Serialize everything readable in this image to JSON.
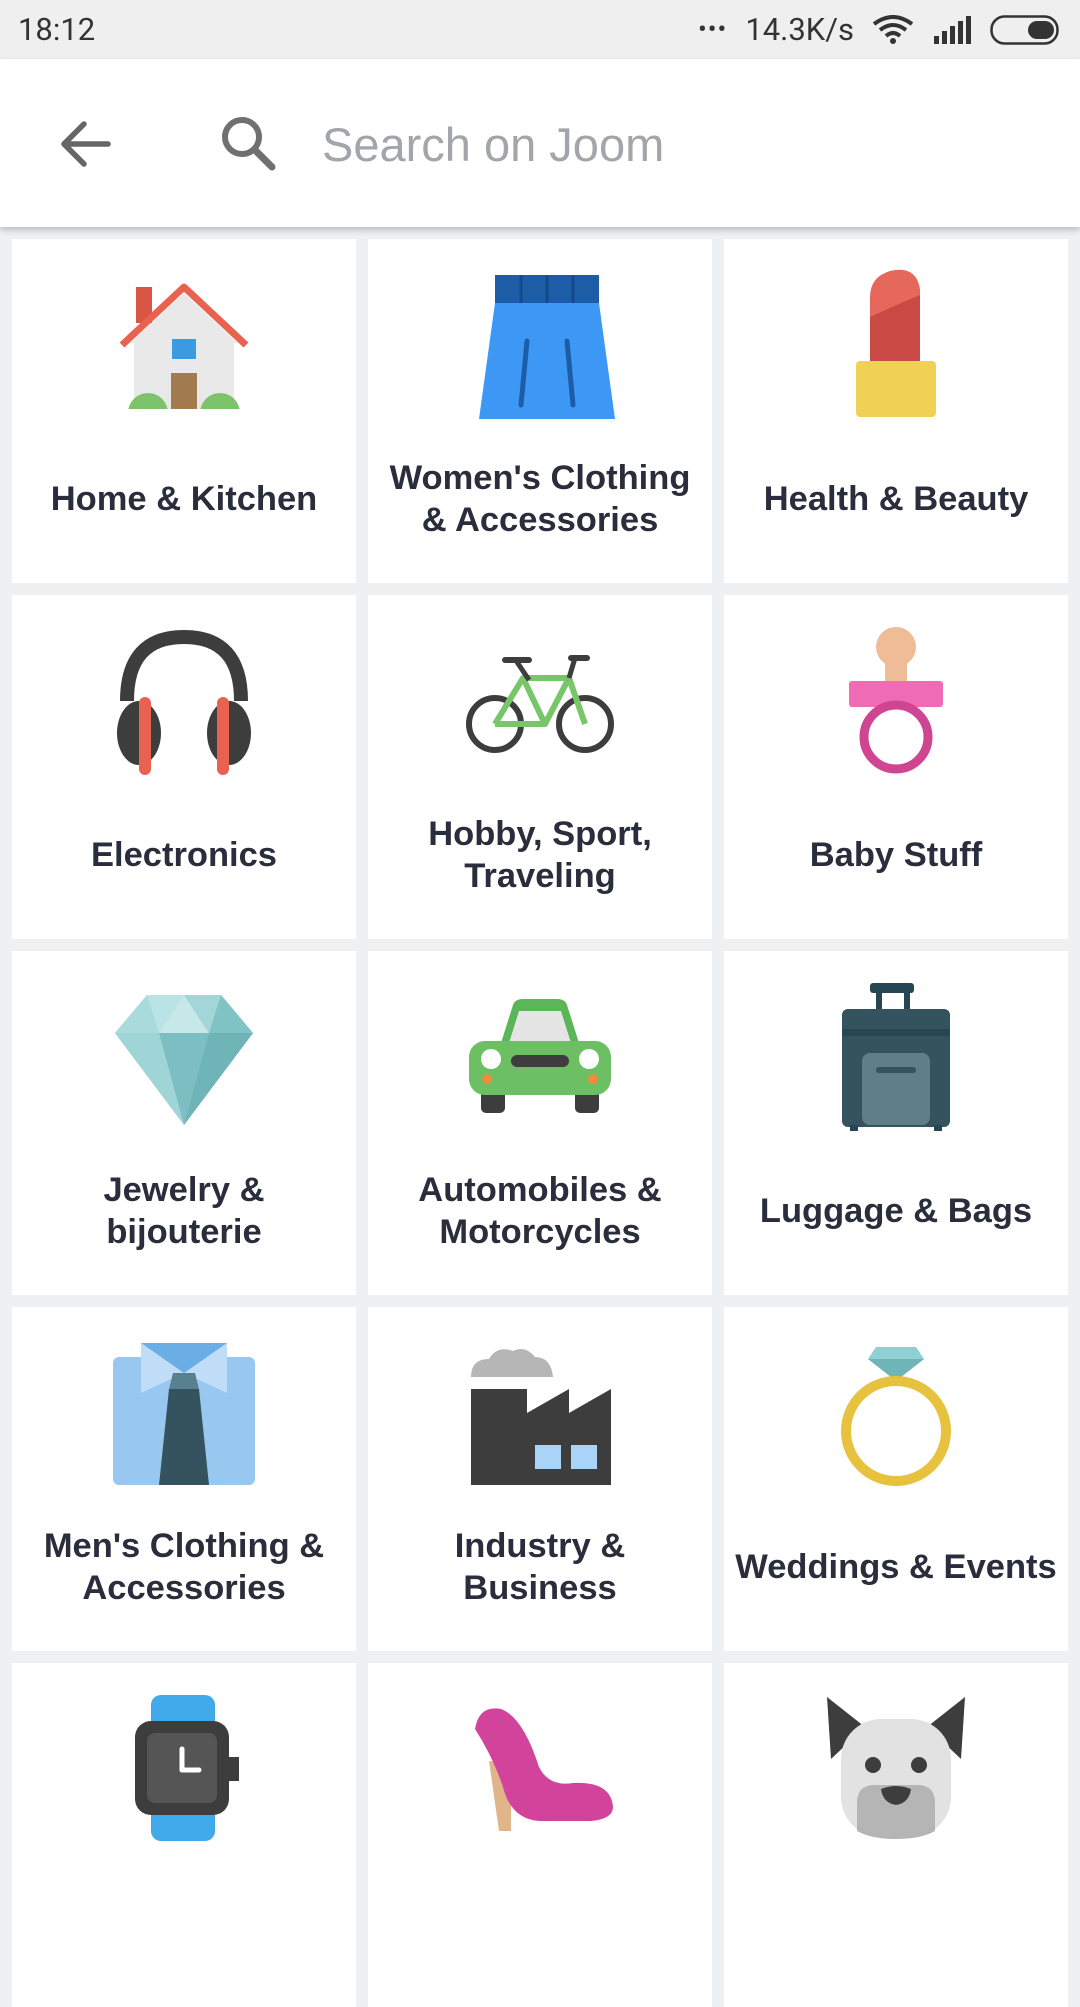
{
  "status_bar": {
    "time": "18:12",
    "dots": "•••",
    "net_speed": "14.3K/s"
  },
  "search": {
    "placeholder": "Search on Joom"
  },
  "categories": [
    {
      "label": "Home & Kitchen",
      "icon": "house-icon"
    },
    {
      "label": "Women's Clothing & Accessories",
      "icon": "skirt-icon"
    },
    {
      "label": "Health & Beauty",
      "icon": "lipstick-icon"
    },
    {
      "label": "Electronics",
      "icon": "headphones-icon"
    },
    {
      "label": "Hobby, Sport, Traveling",
      "icon": "bicycle-icon"
    },
    {
      "label": "Baby Stuff",
      "icon": "pacifier-icon"
    },
    {
      "label": "Jewelry & bijouterie",
      "icon": "diamond-icon"
    },
    {
      "label": "Automobiles & Motorcycles",
      "icon": "car-icon"
    },
    {
      "label": "Luggage & Bags",
      "icon": "suitcase-icon"
    },
    {
      "label": "Men's Clothing & Accessories",
      "icon": "shirt-tie-icon"
    },
    {
      "label": "Industry & Business",
      "icon": "factory-icon"
    },
    {
      "label": "Weddings & Events",
      "icon": "ring-icon"
    },
    {
      "label": "",
      "icon": "watch-icon"
    },
    {
      "label": "",
      "icon": "high-heel-icon"
    },
    {
      "label": "",
      "icon": "dog-icon"
    }
  ],
  "colors": {
    "background": "#eef0f2",
    "tile": "#ffffff",
    "label_text": "#2a2d3b",
    "placeholder": "#a3a5ab"
  }
}
